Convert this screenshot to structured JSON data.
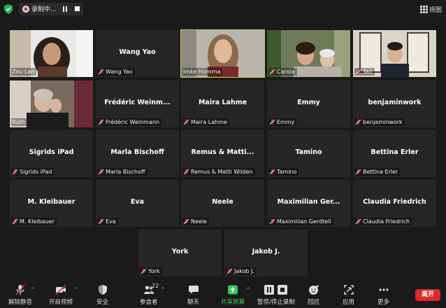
{
  "topbar": {
    "recording_label": "录制中...",
    "view_label": "视图"
  },
  "tiles": [
    {
      "name": "Zou Lan",
      "center": "",
      "video": true
    },
    {
      "name": "Wang Yao",
      "center": "Wang Yao",
      "video": false
    },
    {
      "name": "Imke Homma",
      "center": "",
      "video": true,
      "active": true
    },
    {
      "name": "Carola",
      "center": "",
      "video": true
    },
    {
      "name": "Yao",
      "center": "",
      "video": true
    },
    {
      "name": "Ruth",
      "center": "",
      "video": true
    },
    {
      "name": "Frédéric Weinmann",
      "center": "Frédéric  Weinm...",
      "video": false
    },
    {
      "name": "Maira Lahme",
      "center": "Maira Lahme",
      "video": false
    },
    {
      "name": "Emmy",
      "center": "Emmy",
      "video": false
    },
    {
      "name": "benjaminwork",
      "center": "benjaminwork",
      "video": false
    },
    {
      "name": "Sigrids iPad",
      "center": "Sigrids iPad",
      "video": false
    },
    {
      "name": "Marla Bischoff",
      "center": "Marla Bischoff",
      "video": false
    },
    {
      "name": "Remus & Matti Wilden",
      "center": "Remus & Matti...",
      "video": false
    },
    {
      "name": "Tamino",
      "center": "Tamino",
      "video": false
    },
    {
      "name": "Bettina Erler",
      "center": "Bettina Erler",
      "video": false
    },
    {
      "name": "M. Kleibauer",
      "center": "M. Kleibauer",
      "video": false
    },
    {
      "name": "Eva",
      "center": "Eva",
      "video": false
    },
    {
      "name": "Neele",
      "center": "Neele",
      "video": false
    },
    {
      "name": "Maximilian Gerdtell",
      "center": "Maximilian  Ger...",
      "video": false
    },
    {
      "name": "Claudia Friedrich",
      "center": "Claudia Friedrich",
      "video": false
    },
    {
      "name": "York",
      "center": "York",
      "video": false
    },
    {
      "name": "Jakob J.",
      "center": "Jakob J.",
      "video": false
    }
  ],
  "toolbar": {
    "unmute": "解除静音",
    "start_video": "开启视频",
    "security": "安全",
    "participants": "参会者",
    "participants_count": "22",
    "chat": "聊天",
    "share_screen": "共享屏幕",
    "pause_stop_recording": "暂停/停止录制",
    "reactions": "回应",
    "apps": "应用",
    "more": "更多",
    "leave": "离开"
  },
  "colors": {
    "active_speaker": "#c8d24e",
    "share_green": "#2fcf54",
    "leave_red": "#e02828",
    "muted_red": "#e03030"
  }
}
